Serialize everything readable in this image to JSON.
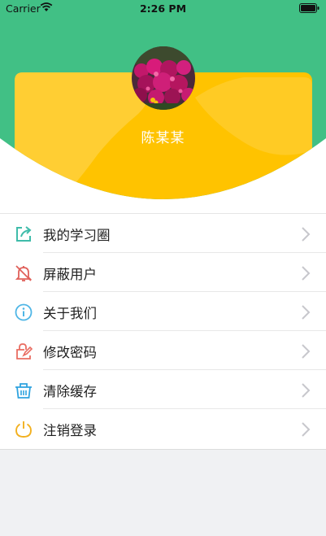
{
  "status_bar": {
    "carrier": "Carrier",
    "time": "2:26 PM"
  },
  "profile": {
    "name": "陈某某"
  },
  "menu": {
    "items": [
      {
        "label": "我的学习圈",
        "icon": "share-icon"
      },
      {
        "label": "屏蔽用户",
        "icon": "bell-off-icon"
      },
      {
        "label": "关于我们",
        "icon": "info-icon"
      },
      {
        "label": "修改密码",
        "icon": "edit-lock-icon"
      },
      {
        "label": "清除缓存",
        "icon": "basket-icon"
      },
      {
        "label": "注销登录",
        "icon": "power-icon"
      }
    ]
  },
  "colors": {
    "header_green": "#41c085",
    "card_yellow": "#ffc300",
    "card_light": "#ffce33",
    "share": "#3fbcaa",
    "bell_off": "#e0605a",
    "info": "#4fb6e6",
    "edit_lock": "#e96d62",
    "basket": "#2fa3df",
    "power": "#f2b01f",
    "chevron": "#c7c7cc"
  }
}
